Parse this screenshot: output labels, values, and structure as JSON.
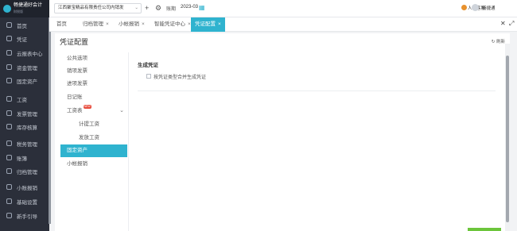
{
  "app": {
    "logo_text": "畅捷通好会计",
    "logo_sub": "财税版"
  },
  "sidebar": {
    "items": [
      {
        "label": "首页"
      },
      {
        "label": "凭证"
      },
      {
        "label": "云报表中心"
      },
      {
        "label": "资金管理"
      },
      {
        "label": "固定资产"
      },
      {
        "label": "工资"
      },
      {
        "label": "发票管理"
      },
      {
        "label": "库存核算"
      },
      {
        "label": "税务管理"
      },
      {
        "label": "账簿"
      },
      {
        "label": "归档管理"
      },
      {
        "label": "小账报销"
      },
      {
        "label": "基础设置"
      },
      {
        "label": "新手引导"
      }
    ]
  },
  "topbar": {
    "company": "江西聚宝精品有限责任公司内销发",
    "period_label": "账期",
    "period_value": "2023-03",
    "support": "人工客服",
    "user": "畅捷通"
  },
  "tabs": [
    {
      "label": "首页",
      "closable": false
    },
    {
      "label": "归档管理",
      "closable": true
    },
    {
      "label": "小帐报销",
      "closable": true
    },
    {
      "label": "智能凭证中心",
      "closable": true
    },
    {
      "label": "凭证配置",
      "closable": true
    }
  ],
  "panel": {
    "title": "凭证配置",
    "refresh": "刷新"
  },
  "subnav": [
    {
      "label": "公共选项"
    },
    {
      "label": "销项发票"
    },
    {
      "label": "进项发票"
    },
    {
      "label": "日记账"
    },
    {
      "label": "工资表",
      "badge": "NEW"
    },
    {
      "label": "计提工资"
    },
    {
      "label": "发放工资"
    },
    {
      "label": "固定资产"
    },
    {
      "label": "小帐报销"
    }
  ],
  "content": {
    "section_title": "生成凭证",
    "checkbox_label": "按凭证类型合并生成凭证",
    "checked": false
  },
  "colors": {
    "accent": "#2fb3cf",
    "sidebar_bg": "#2b2f3a",
    "badge": "#e84d3d"
  }
}
